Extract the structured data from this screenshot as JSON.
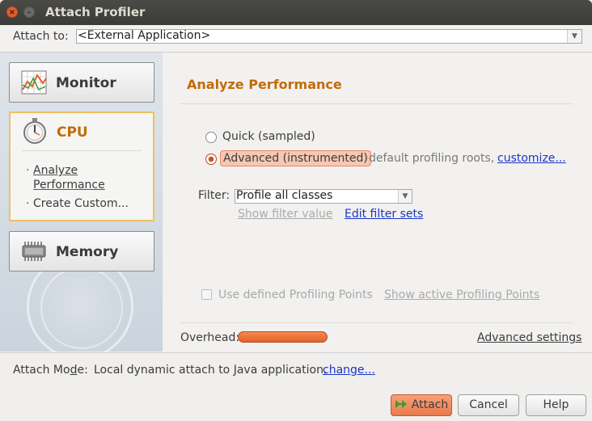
{
  "window": {
    "title": "Attach Profiler"
  },
  "attach_to": {
    "label": "Attach to:",
    "value": "<External Application>"
  },
  "nav": {
    "monitor": {
      "label": "Monitor"
    },
    "cpu": {
      "label": "CPU",
      "sub_items": [
        "Analyze Performance",
        "Create Custom..."
      ]
    },
    "memory": {
      "label": "Memory"
    }
  },
  "panel": {
    "title": "Analyze Performance",
    "quick_label": "Quick (sampled)",
    "advanced_label": "Advanced (instrumented)",
    "default_roots_text": "default profiling roots,",
    "customize_link": "customize...",
    "filter_label": "Filter:",
    "filter_value": "Profile all classes",
    "show_filter_link": "Show filter value",
    "edit_filter_link": "Edit filter sets",
    "defined_points_label": "Use defined Profiling Points",
    "show_points_link": "Show active Profiling Points",
    "overhead_label": "Overhead:",
    "advanced_settings_link": "Advanced settings"
  },
  "attach_mode": {
    "label_pre": "Attach Mo",
    "label_u": "d",
    "label_post": "e:",
    "value": "Local dynamic attach to Java application,",
    "change_link": "change..."
  },
  "buttons": {
    "attach": "Attach",
    "cancel": "Cancel",
    "help": "Help"
  },
  "colors": {
    "accent": "#c36b06",
    "highlight": "#f7c7b2",
    "link": "#1a35c4",
    "overhead_bar": "#e2622a"
  },
  "icons": [
    "close-icon",
    "minimize-icon",
    "monitor-chart-icon",
    "stopwatch-icon",
    "memory-chip-icon",
    "attach-run-icon"
  ]
}
